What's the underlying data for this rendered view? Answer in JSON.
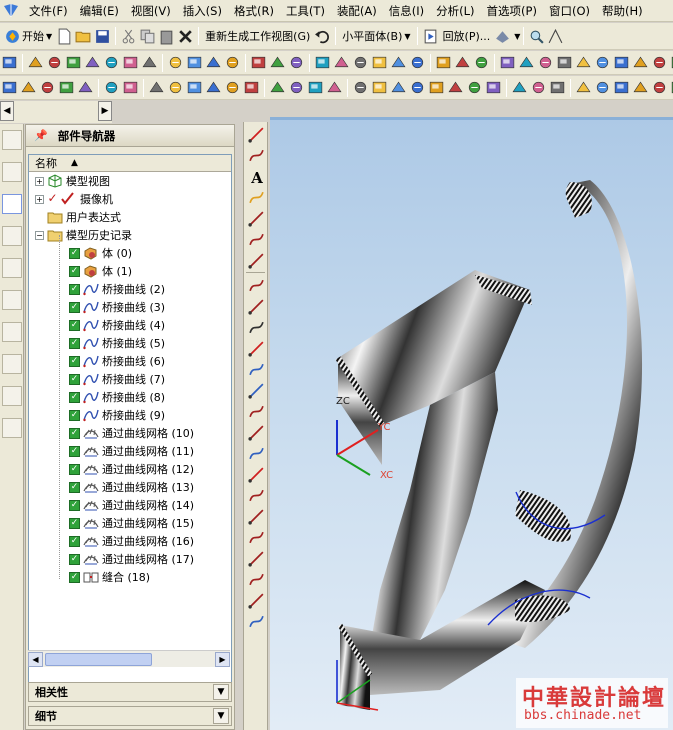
{
  "menu": [
    "文件(F)",
    "编辑(E)",
    "视图(V)",
    "插入(S)",
    "格式(R)",
    "工具(T)",
    "装配(A)",
    "信息(I)",
    "分析(L)",
    "首选项(P)",
    "窗口(O)",
    "帮助(H)"
  ],
  "toolbar1": {
    "start_label": "开始",
    "regen_label": "重新生成工作视图(G)",
    "face_select": "小平面体(B)",
    "replay_label": "回放(P)..."
  },
  "navigator": {
    "title": "部件导航器",
    "column_name": "名称",
    "items": [
      {
        "label": "模型视图",
        "level": 0,
        "expander": "+"
      },
      {
        "label": "摄像机",
        "level": 0,
        "expander": "+"
      },
      {
        "label": "用户表达式",
        "level": 0,
        "expander": ""
      },
      {
        "label": "模型历史记录",
        "level": 0,
        "expander": "−"
      },
      {
        "label": "体 (0)",
        "level": 1,
        "checked": true,
        "kind": "body"
      },
      {
        "label": "体 (1)",
        "level": 1,
        "checked": true,
        "kind": "body"
      },
      {
        "label": "桥接曲线 (2)",
        "level": 1,
        "checked": true,
        "kind": "curve"
      },
      {
        "label": "桥接曲线 (3)",
        "level": 1,
        "checked": true,
        "kind": "curve"
      },
      {
        "label": "桥接曲线 (4)",
        "level": 1,
        "checked": true,
        "kind": "curve"
      },
      {
        "label": "桥接曲线 (5)",
        "level": 1,
        "checked": true,
        "kind": "curve"
      },
      {
        "label": "桥接曲线 (6)",
        "level": 1,
        "checked": true,
        "kind": "curve"
      },
      {
        "label": "桥接曲线 (7)",
        "level": 1,
        "checked": true,
        "kind": "curve"
      },
      {
        "label": "桥接曲线 (8)",
        "level": 1,
        "checked": true,
        "kind": "curve"
      },
      {
        "label": "桥接曲线 (9)",
        "level": 1,
        "checked": true,
        "kind": "curve"
      },
      {
        "label": "通过曲线网格 (10)",
        "level": 1,
        "checked": true,
        "kind": "mesh"
      },
      {
        "label": "通过曲线网格 (11)",
        "level": 1,
        "checked": true,
        "kind": "mesh"
      },
      {
        "label": "通过曲线网格 (12)",
        "level": 1,
        "checked": true,
        "kind": "mesh"
      },
      {
        "label": "通过曲线网格 (13)",
        "level": 1,
        "checked": true,
        "kind": "mesh"
      },
      {
        "label": "通过曲线网格 (14)",
        "level": 1,
        "checked": true,
        "kind": "mesh"
      },
      {
        "label": "通过曲线网格 (15)",
        "level": 1,
        "checked": true,
        "kind": "mesh"
      },
      {
        "label": "通过曲线网格 (16)",
        "level": 1,
        "checked": true,
        "kind": "mesh"
      },
      {
        "label": "通过曲线网格 (17)",
        "level": 1,
        "checked": true,
        "kind": "mesh"
      },
      {
        "label": "缝合 (18)",
        "level": 1,
        "checked": true,
        "kind": "sew"
      }
    ],
    "panels": [
      "相关性",
      "细节"
    ]
  },
  "viewport": {
    "axis_labels": {
      "zc": "ZC",
      "yc": "YC",
      "xc": "XC"
    },
    "watermark_title": "中華設計論壇",
    "watermark_url": "bbs.chinade.net"
  },
  "colors": {
    "accent": "#2b6fd6",
    "check_green": "#2fa23a",
    "viewport_top": "#adc9e6",
    "watermark_red": "#d93a3a"
  }
}
